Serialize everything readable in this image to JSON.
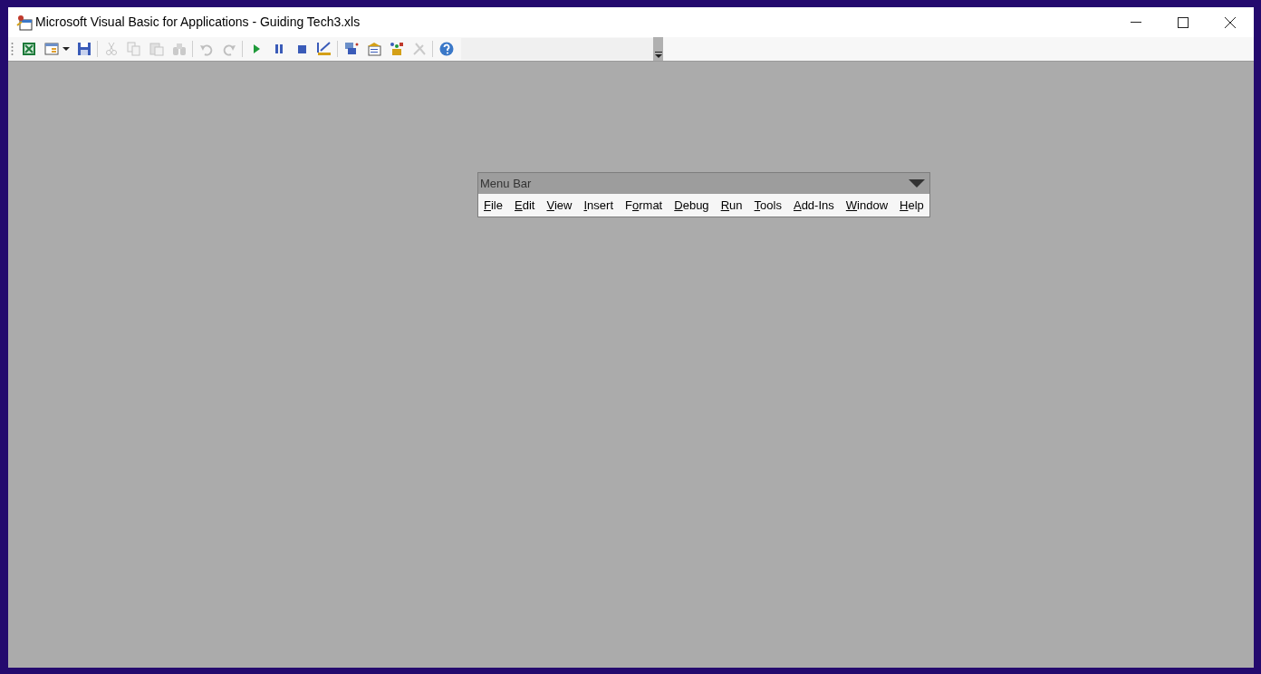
{
  "window": {
    "title": "Microsoft Visual Basic for Applications - Guiding Tech3.xls"
  },
  "toolbar": [
    {
      "kind": "excel",
      "disabled": false
    },
    {
      "kind": "insert-form",
      "disabled": false
    },
    {
      "kind": "save",
      "disabled": false
    },
    {
      "kind": "cut",
      "disabled": true
    },
    {
      "kind": "copy",
      "disabled": true
    },
    {
      "kind": "paste",
      "disabled": true
    },
    {
      "kind": "find",
      "disabled": true
    },
    {
      "kind": "undo",
      "disabled": true
    },
    {
      "kind": "redo",
      "disabled": true
    },
    {
      "kind": "run",
      "disabled": false
    },
    {
      "kind": "pause",
      "disabled": false
    },
    {
      "kind": "stop",
      "disabled": false
    },
    {
      "kind": "design",
      "disabled": false
    },
    {
      "kind": "project",
      "disabled": false
    },
    {
      "kind": "properties",
      "disabled": false
    },
    {
      "kind": "objects",
      "disabled": false
    },
    {
      "kind": "toolbox",
      "disabled": true
    },
    {
      "kind": "help",
      "disabled": false
    }
  ],
  "menu_bar": {
    "title": "Menu Bar",
    "items": [
      {
        "key": "F",
        "rest": "ile"
      },
      {
        "key": "E",
        "rest": "dit"
      },
      {
        "key": "V",
        "rest": "iew"
      },
      {
        "key": "I",
        "rest": "nsert"
      },
      {
        "lead": "F",
        "key": "o",
        "rest": "rmat"
      },
      {
        "key": "D",
        "rest": "ebug"
      },
      {
        "key": "R",
        "rest": "un"
      },
      {
        "key": "T",
        "rest": "ools"
      },
      {
        "key": "A",
        "rest": "dd-Ins"
      },
      {
        "key": "W",
        "rest": "indow"
      },
      {
        "key": "H",
        "rest": "elp"
      }
    ]
  }
}
